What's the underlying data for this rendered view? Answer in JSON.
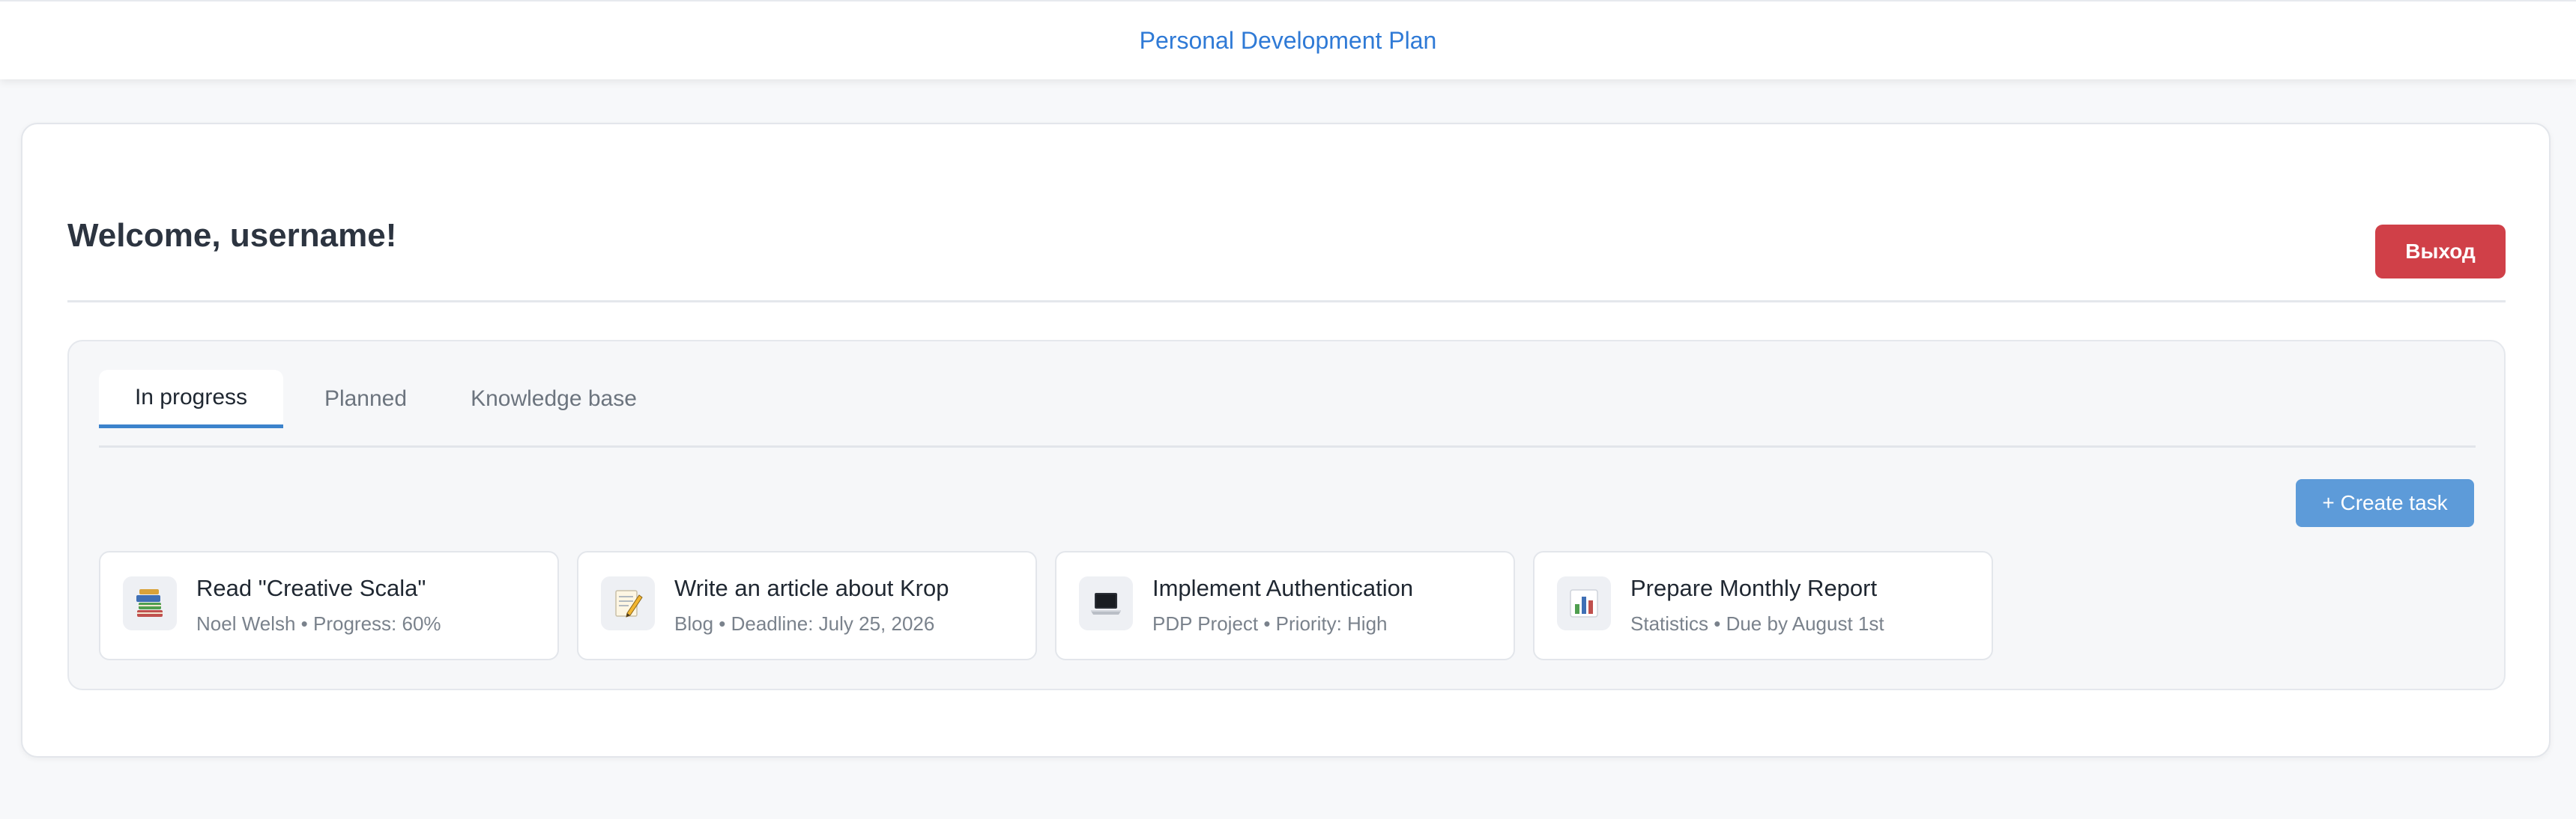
{
  "header": {
    "app_title": "Personal Development Plan"
  },
  "welcome": {
    "title": "Welcome, username!",
    "logout_label": "Выход"
  },
  "tabs": [
    {
      "label": "In progress",
      "active": true
    },
    {
      "label": "Planned",
      "active": false
    },
    {
      "label": "Knowledge base",
      "active": false
    }
  ],
  "toolbar": {
    "create_task_label": "+ Create task"
  },
  "tasks": [
    {
      "icon": "books-icon",
      "title": "Read \"Creative Scala\"",
      "meta": "Noel Welsh • Progress: 60%"
    },
    {
      "icon": "memo-icon",
      "title": "Write an article about Krop",
      "meta": "Blog • Deadline: July 25, 2026"
    },
    {
      "icon": "laptop-icon",
      "title": "Implement Authentication",
      "meta": "PDP Project • Priority: High"
    },
    {
      "icon": "bar-chart-icon",
      "title": "Prepare Monthly Report",
      "meta": "Statistics • Due by August 1st"
    }
  ],
  "colors": {
    "accent": "#2f7ad6",
    "tab_underline": "#3c83cc",
    "create_button": "#5d9bd9",
    "logout_button": "#d04048"
  }
}
